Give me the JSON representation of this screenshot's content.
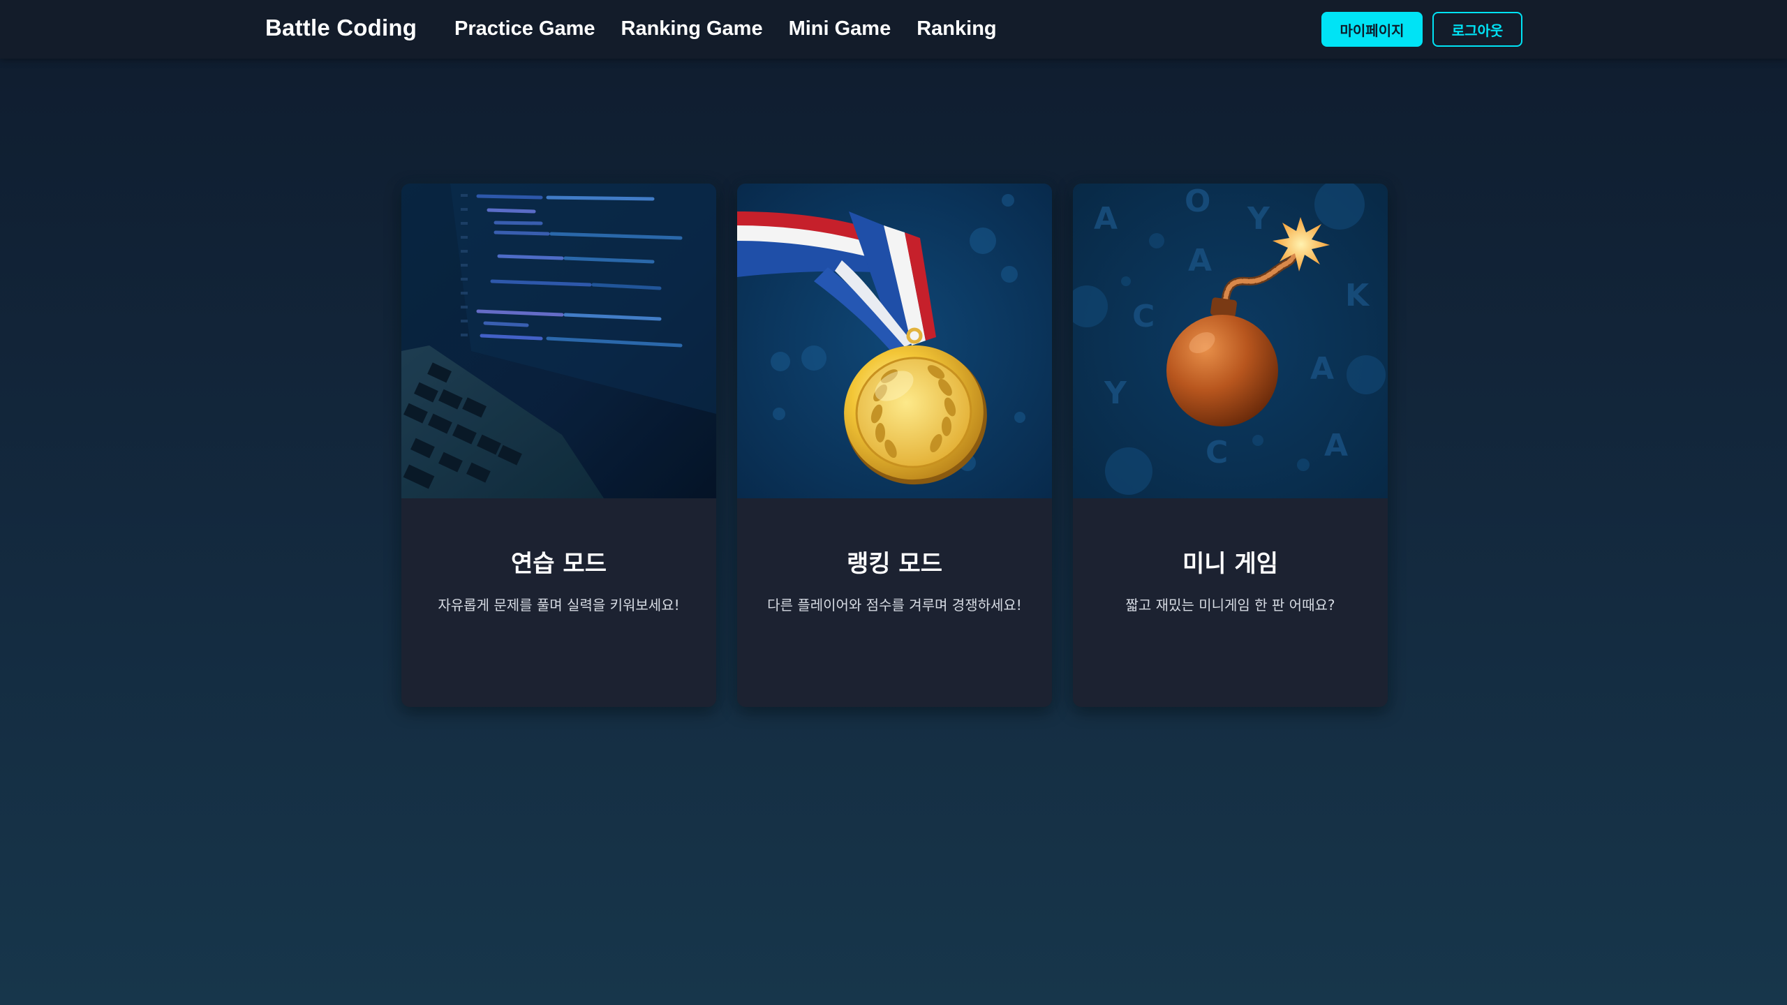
{
  "navbar": {
    "brand": "Battle Coding",
    "links": [
      {
        "label": "Practice Game"
      },
      {
        "label": "Ranking Game"
      },
      {
        "label": "Mini Game"
      },
      {
        "label": "Ranking"
      }
    ],
    "mypage_label": "마이페이지",
    "logout_label": "로그아웃"
  },
  "colors": {
    "accent": "#00e3f5",
    "navbar_bg": "#131c2a",
    "card_bg": "#1c2231"
  },
  "cards": [
    {
      "title": "연습 모드",
      "description": "자유롭게 문제를 풀며 실력을 키워보세요!",
      "image": "laptop-code-image"
    },
    {
      "title": "랭킹 모드",
      "description": "다른 플레이어와 점수를 겨루며 경쟁하세요!",
      "image": "gold-medal-image"
    },
    {
      "title": "미니 게임",
      "description": "짧고 재밌는 미니게임 한 판 어때요?",
      "image": "bomb-image"
    }
  ]
}
